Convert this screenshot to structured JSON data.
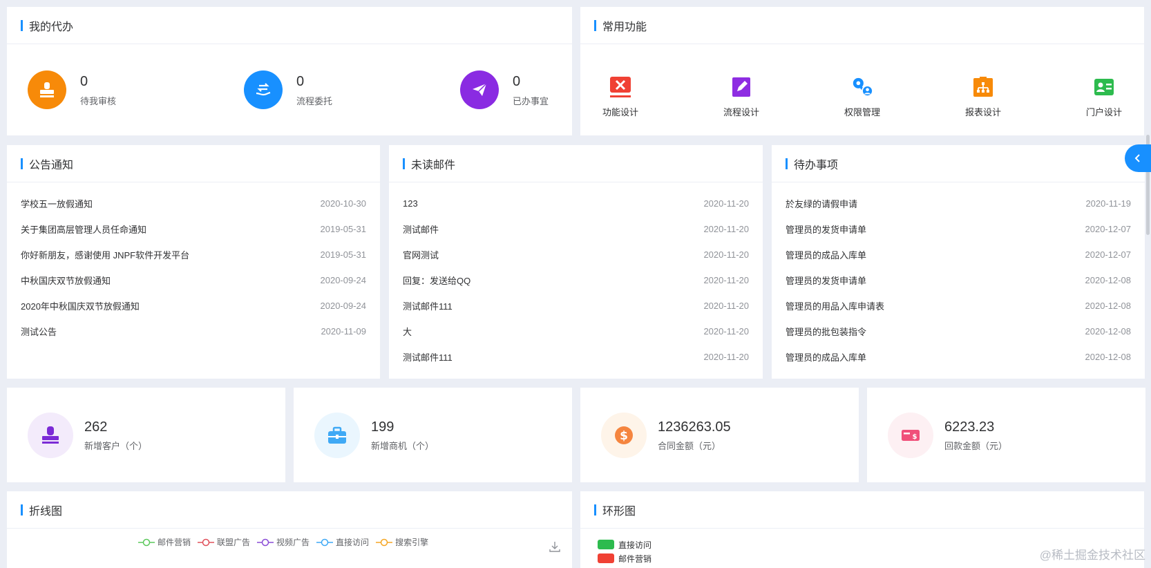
{
  "todo": {
    "title": "我的代办",
    "items": [
      {
        "value": "0",
        "label": "待我审核",
        "color": "#f78a09"
      },
      {
        "value": "0",
        "label": "流程委托",
        "color": "#1890ff"
      },
      {
        "value": "0",
        "label": "已办事宜",
        "color": "#8a2be2"
      }
    ]
  },
  "functions": {
    "title": "常用功能",
    "items": [
      {
        "label": "功能设计",
        "icon": "design-tools-icon",
        "color": "#f04134"
      },
      {
        "label": "流程设计",
        "icon": "edit-icon",
        "color": "#8e2de2"
      },
      {
        "label": "权限管理",
        "icon": "key-user-icon",
        "color": "#1890ff"
      },
      {
        "label": "报表设计",
        "icon": "report-tree-icon",
        "color": "#f78a09"
      },
      {
        "label": "门户设计",
        "icon": "portal-card-icon",
        "color": "#2dbb4e"
      }
    ]
  },
  "notices": {
    "title": "公告通知",
    "rows": [
      {
        "title": "学校五一放假通知",
        "date": "2020-10-30"
      },
      {
        "title": "关于集团高层管理人员任命通知",
        "date": "2019-05-31"
      },
      {
        "title": "你好新朋友，感谢使用 JNPF软件开发平台",
        "date": "2019-05-31"
      },
      {
        "title": "中秋国庆双节放假通知",
        "date": "2020-09-24"
      },
      {
        "title": "2020年中秋国庆双节放假通知",
        "date": "2020-09-24"
      },
      {
        "title": "测试公告",
        "date": "2020-11-09"
      }
    ]
  },
  "mails": {
    "title": "未读邮件",
    "rows": [
      {
        "title": "123",
        "date": "2020-11-20"
      },
      {
        "title": "测试邮件",
        "date": "2020-11-20"
      },
      {
        "title": "官网测试",
        "date": "2020-11-20"
      },
      {
        "title": "回复：发送给QQ",
        "date": "2020-11-20"
      },
      {
        "title": "测试邮件111",
        "date": "2020-11-20"
      },
      {
        "title": "大",
        "date": "2020-11-20"
      },
      {
        "title": "测试邮件111",
        "date": "2020-11-20"
      }
    ]
  },
  "tasks": {
    "title": "待办事项",
    "rows": [
      {
        "title": "於友绿的请假申请",
        "date": "2020-11-19"
      },
      {
        "title": "管理员的发货申请单",
        "date": "2020-12-07"
      },
      {
        "title": "管理员的成品入库单",
        "date": "2020-12-07"
      },
      {
        "title": "管理员的发货申请单",
        "date": "2020-12-08"
      },
      {
        "title": "管理员的用品入库申请表",
        "date": "2020-12-08"
      },
      {
        "title": "管理员的批包装指令",
        "date": "2020-12-08"
      },
      {
        "title": "管理员的成品入库单",
        "date": "2020-12-08"
      }
    ]
  },
  "stats": [
    {
      "value": "262",
      "label": "新增客户（个）",
      "color": "#7b2bd6",
      "bg": "#f3ebfb"
    },
    {
      "value": "199",
      "label": "新增商机（个）",
      "color": "#3fa9f5",
      "bg": "#eaf6fe"
    },
    {
      "value": "1236263.05",
      "label": "合同金额（元）",
      "color": "#f5853f",
      "bg": "#fef4e9"
    },
    {
      "value": "6223.23",
      "label": "回款金额（元）",
      "color": "#f0507a",
      "bg": "#fdf0f3"
    }
  ],
  "line_chart": {
    "title": "折线图",
    "legend": [
      {
        "name": "邮件营销",
        "color": "#5bc85b"
      },
      {
        "name": "联盟广告",
        "color": "#e0505a"
      },
      {
        "name": "视频广告",
        "color": "#8a4cd6"
      },
      {
        "name": "直接访问",
        "color": "#3fa9f5"
      },
      {
        "name": "搜索引擎",
        "color": "#f5a623"
      }
    ]
  },
  "donut_chart": {
    "title": "环形图",
    "legend": [
      {
        "name": "直接访问",
        "color": "#2dbb4e"
      },
      {
        "name": "邮件营销",
        "color": "#f04134"
      }
    ]
  },
  "watermark": "@稀土掘金技术社区"
}
